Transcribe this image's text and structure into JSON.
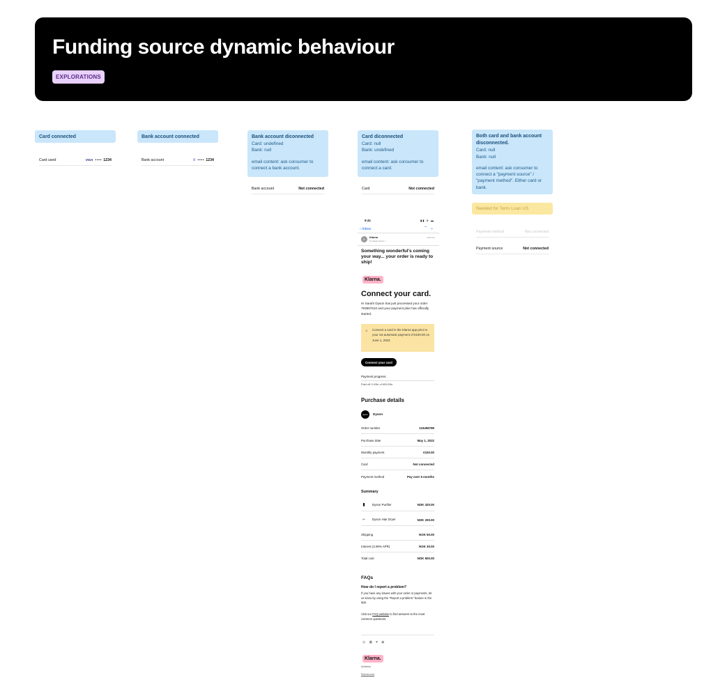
{
  "header": {
    "title": "Funding source dynamic behaviour",
    "tag": "EXPLORATIONS"
  },
  "col1": {
    "note_title": "Card connected",
    "row_label": "Card used",
    "brand": "VISA",
    "dots": "••••",
    "last4": "1234"
  },
  "col2": {
    "note_title": "Bank account connected",
    "row_label": "Bank account",
    "bank_glyph": "ıll",
    "dots": "••••",
    "last4": "1234"
  },
  "col3": {
    "note_title": "Bank account diconnected",
    "lines": [
      "Card: undefined",
      "Bank: null"
    ],
    "email_note": "email content: ask consumer to connect a bank account.",
    "row_label": "Bank account",
    "row_value": "Not connected"
  },
  "col4": {
    "note_title": "Card diconnected",
    "lines": [
      "Card: null",
      "Bank: undefined"
    ],
    "email_note": "email content: ask consumer to connect a card.",
    "row_label": "Card",
    "row_value": "Not connected"
  },
  "col5": {
    "note_title": "Both card and bank account disconnected.",
    "lines": [
      "Card: null",
      "Bank: null"
    ],
    "email_note": "email content: ask consumer to connect a \"payment source\" / \"payment method\". Either card or bank.",
    "needed": "Needed for Term Loan US",
    "faded_label": "Payment method",
    "faded_value": "Not connected",
    "row_label": "Payment source",
    "row_value": "Not connected"
  },
  "email": {
    "time": "9:41",
    "status_icons": "▮▮ ≋ ▬",
    "inbox": "Inbox",
    "sender": "Klarna",
    "sender_sub": "To Sarah Dyson >",
    "date": "06/01/22",
    "subject": "Something wonderful's coming your way... your order is ready to ship!",
    "logo": "Klarna.",
    "title": "Connect your card.",
    "intro": "Hi Sarah! Dyson has just processed your order 793957610 and your payment plan has officially started.",
    "warning": "Connect a card in the Klarna app prior to your 1st automatic payment of €100.00 on June 1, 2022.",
    "button": "Connect your card",
    "progress_label": "Payment progress",
    "progress_value": 0,
    "progress_text": "Paid off: 0.00kr of 600.00kr",
    "purchase_title": "Purchase details",
    "merchant_logo": "dyson",
    "merchant": "Dyson",
    "details": [
      {
        "label": "Order number",
        "value": "123456789"
      },
      {
        "label": "Purchase date",
        "value": "May 1, 2022"
      },
      {
        "label": "Monthly payment",
        "value": "€100.00"
      },
      {
        "label": "Card",
        "value": "Not connected"
      },
      {
        "label": "Payment method",
        "value": "Pay over 6 months"
      }
    ],
    "summary_title": "Summary",
    "products": [
      {
        "label": "Dyson Purifier",
        "value": "NOK 320.00",
        "icon": "purifier-icon"
      },
      {
        "label": "Dyson Hair Dryer",
        "value": "NOK 200.00",
        "icon": "hair-dryer-icon"
      }
    ],
    "totals": [
      {
        "label": "Shipping",
        "value": "NOK 50.00"
      },
      {
        "label": "Interest (2.99% APR)",
        "value": "NOK 30.00"
      },
      {
        "label": "Total cost",
        "value": "NOK 600.00"
      }
    ],
    "faq_title": "FAQs",
    "faq_q": "How do I report a problem?",
    "faq_a": "If you have any issues with your order or payments, let us know by using the \"Report a problem\" feature in the app.",
    "faq_visit_pre": "Visit our",
    "faq_link": "FAQ website",
    "faq_visit_post": "to find answers to the most common questions.",
    "footer_logo": "Klarna.",
    "address": "Address",
    "site": "Klarna.com"
  }
}
